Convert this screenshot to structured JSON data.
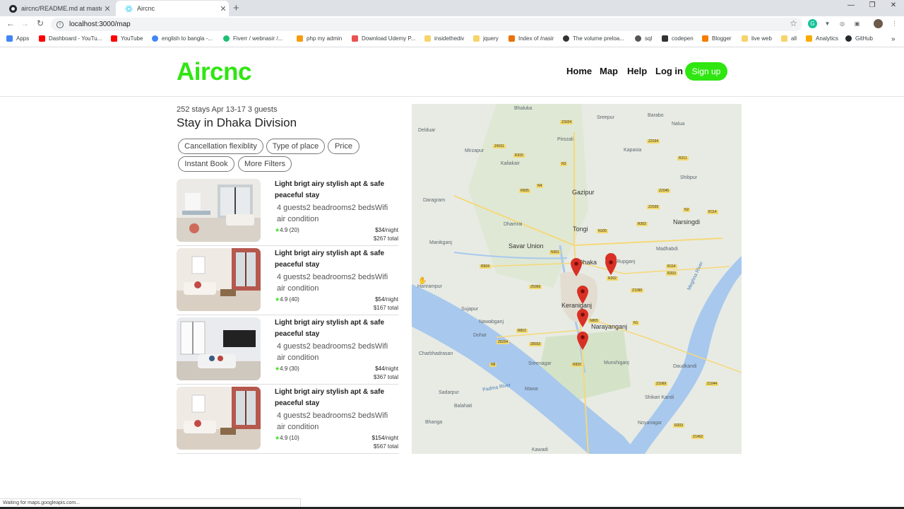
{
  "browser": {
    "tabs": [
      {
        "title": "aircnc/README.md at master · in",
        "active": false,
        "icon": "github-icon"
      },
      {
        "title": "Aircnc",
        "active": true,
        "icon": "react-icon"
      }
    ],
    "new_tab": "+",
    "window_controls": {
      "minimize": "—",
      "restore": "❐",
      "close": "✕"
    },
    "url": "localhost:3000/map",
    "bookmarks": [
      {
        "label": "Apps",
        "icon": "apps-grid-icon",
        "color": "#4285f4"
      },
      {
        "label": "Dashboard - YouTu...",
        "icon": "youtube-icon",
        "color": "#ff0000"
      },
      {
        "label": "YouTube",
        "icon": "youtube-icon",
        "color": "#ff0000"
      },
      {
        "label": "english to bangla -...",
        "icon": "google-icon",
        "color": "#4285f4"
      },
      {
        "label": "Fiverr / webnasir /...",
        "icon": "fiverr-icon",
        "color": "#1dbf73"
      },
      {
        "label": "php my admin",
        "icon": "phpmyadmin-icon",
        "color": "#f89c0e"
      },
      {
        "label": "Download Udemy P...",
        "icon": "udemy-icon",
        "color": "#ea5252"
      },
      {
        "label": "insidethediv",
        "icon": "folder-icon",
        "color": "#f5d46b"
      },
      {
        "label": "jquery",
        "icon": "folder-icon",
        "color": "#f5d46b"
      },
      {
        "label": "Index of /nasir",
        "icon": "page-icon",
        "color": "#e8710a"
      },
      {
        "label": "The volume preloa...",
        "icon": "gear-icon",
        "color": "#333333"
      },
      {
        "label": "sql",
        "icon": "globe-icon",
        "color": "#555555"
      },
      {
        "label": "codepen",
        "icon": "codepen-icon",
        "color": "#333333"
      },
      {
        "label": "Blogger",
        "icon": "blogger-icon",
        "color": "#f57d00"
      },
      {
        "label": "live web",
        "icon": "folder-icon",
        "color": "#f5d46b"
      },
      {
        "label": "all",
        "icon": "folder-icon",
        "color": "#f5d46b"
      },
      {
        "label": "Analytics",
        "icon": "analytics-icon",
        "color": "#f9ab00"
      },
      {
        "label": "GitHub",
        "icon": "github-icon",
        "color": "#24292e"
      }
    ],
    "bookmarks_more": "»",
    "status_text": "Waiting for maps.googleapis.com..."
  },
  "site": {
    "logo": "Aircnc",
    "nav": [
      "Home",
      "Map",
      "Help",
      "Log in"
    ],
    "signup": "Sign up",
    "brand_color": "#2fe611"
  },
  "results": {
    "summary": "252 stays Apr 13-17 3 guests",
    "heading": "Stay in Dhaka Division",
    "filters": [
      "Cancellation flexiblity",
      "Type of place",
      "Price",
      "Instant Book",
      "More Filters"
    ],
    "listings": [
      {
        "title": "Light brigt airy stylish apt & safe peaceful stay",
        "description": "4 guests2 beadrooms2 bedsWifi air condition",
        "rating": "4.9 (20)",
        "price": "$34",
        "per": "/night",
        "total": "$267 total"
      },
      {
        "title": "Light brigt airy stylish apt & safe peaceful stay",
        "description": "4 guests2 beadrooms2 bedsWifi air condition",
        "rating": "4.9 (40)",
        "price": "$54",
        "per": "/night",
        "total": "$167 total"
      },
      {
        "title": "Light brigt airy stylish apt & safe peaceful stay",
        "description": "4 guests2 beadrooms2 bedsWifi air condition",
        "rating": "4.9 (30)",
        "price": "$44",
        "per": "/night",
        "total": "$367 total"
      },
      {
        "title": "Light brigt airy stylish apt & safe peaceful stay",
        "description": "4 guests2 beadrooms2 bedsWifi air condition",
        "rating": "4.9 (10)",
        "price": "$154",
        "per": "/night",
        "total": "$567 total"
      }
    ]
  },
  "map": {
    "places": [
      "Gazipur",
      "Tongi",
      "Savar Union",
      "Dhaka",
      "Keraniganj",
      "Narayanganj",
      "Munshiganj",
      "Narsingdi",
      "Kaliakair",
      "Dhamrai",
      "Mirzapur",
      "Sreepur",
      "Kapasia",
      "Shibpur",
      "Madhabdi",
      "Rupganj",
      "Manikganj",
      "Harirampur",
      "Sujapur",
      "Nawabganj",
      "Dohar",
      "Sreenagar",
      "Charbhadrasan",
      "Sadarpur",
      "Bhanga",
      "Shikari Kandi",
      "Noyanagar",
      "Daudkandi",
      "Barabo",
      "Nalua",
      "Pirozali",
      "Delduar",
      "Daragram",
      "Mawa",
      "Kawadi",
      "Balahati",
      "Bhaluka"
    ],
    "rivers": [
      "Padma River",
      "Meghna River"
    ],
    "roads": [
      "Z3024",
      "Z4011",
      "R315",
      "N4",
      "R505",
      "N3",
      "R302",
      "Z2034",
      "R211",
      "Z2045",
      "N2",
      "Z2039",
      "R114",
      "N105",
      "N301",
      "R504",
      "R202",
      "Z5069",
      "Z1090",
      "R114",
      "R203",
      "N1",
      "R810",
      "N805",
      "Z8204",
      "Z8033",
      "N8",
      "R820",
      "Z1069",
      "Z1044",
      "Z1402",
      "R203"
    ],
    "pin_color": "#d93025"
  }
}
